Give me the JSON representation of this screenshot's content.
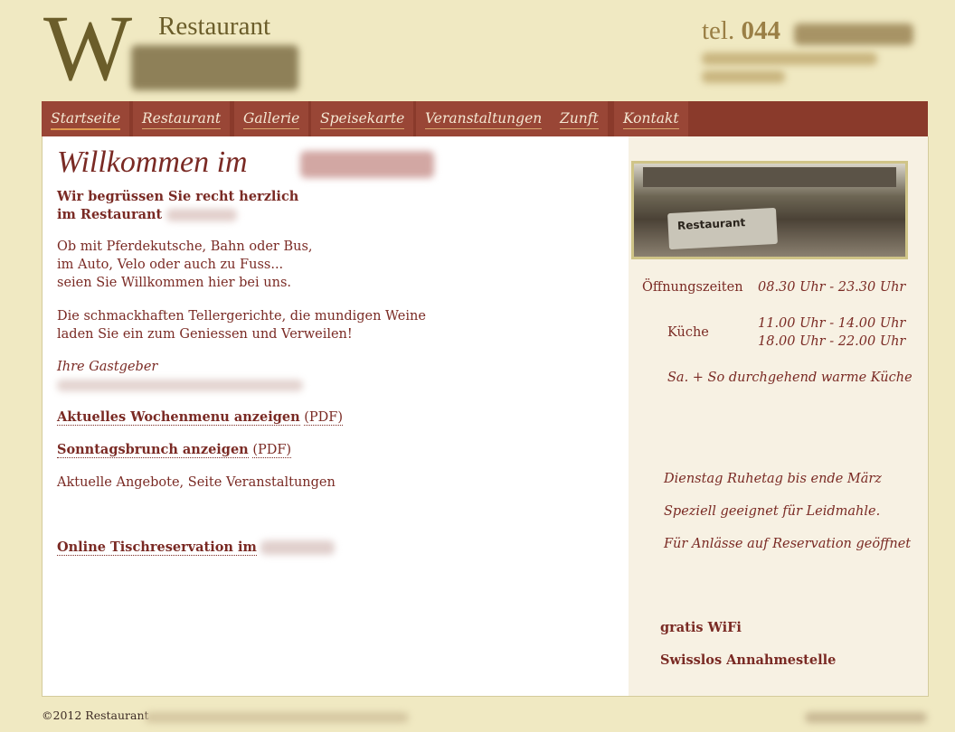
{
  "header": {
    "logo_letter": "W",
    "logo_word": "Restaurant",
    "phone_prefix": "tel.",
    "phone_visible": "044"
  },
  "nav": {
    "items": [
      {
        "label": "Startseite",
        "active": true
      },
      {
        "label": "Restaurant"
      },
      {
        "label": "Gallerie"
      },
      {
        "label": "Speisekarte"
      },
      {
        "label": "Veranstaltungen"
      },
      {
        "label": "Zunft"
      },
      {
        "label": "Kontakt"
      }
    ]
  },
  "main": {
    "welcome": "Willkommen im",
    "greeting_line1": "Wir begrüssen Sie recht herzlich",
    "greeting_line2": "im Restaurant",
    "intro_line1": "Ob mit Pferdekutsche, Bahn oder Bus,",
    "intro_line2": "im Auto, Velo oder auch zu Fuss...",
    "intro_line3": "seien Sie Willkommen hier bei uns.",
    "food_line1": "Die schmackhaften Tellergerichte, die mundigen Weine",
    "food_line2": "laden Sie ein zum Geniessen und Verweilen!",
    "hosts": "Ihre Gastgeber",
    "menu_link": "Aktuelles Wochenmenu anzeigen",
    "menu_pdf": "(PDF)",
    "brunch_link": "Sonntagsbrunch anzeigen",
    "brunch_pdf": "(PDF)",
    "offers": "Aktuelle Angebote, Seite Veranstaltungen",
    "reservation_link": "Online Tischreservation im"
  },
  "sidebar": {
    "photo_sign": "Restaurant",
    "opening_label": "Öffnungszeiten",
    "opening_value": "08.30 Uhr - 23.30 Uhr",
    "kitchen_label": "Küche",
    "kitchen_value1": "11.00 Uhr - 14.00 Uhr",
    "kitchen_value2": "18.00 Uhr - 22.00 Uhr",
    "weekend": "Sa. + So durchgehend warme Küche",
    "note1": "Dienstag Ruhetag bis ende März",
    "note2": "Speziell geeignet für Leidmahle.",
    "note3": "Für Anlässe auf Reservation geöffnet",
    "wifi": "gratis WiFi",
    "swisslos": "Swisslos Annahmestelle"
  },
  "footer": {
    "copyright": "©2012 Restaurant"
  }
}
